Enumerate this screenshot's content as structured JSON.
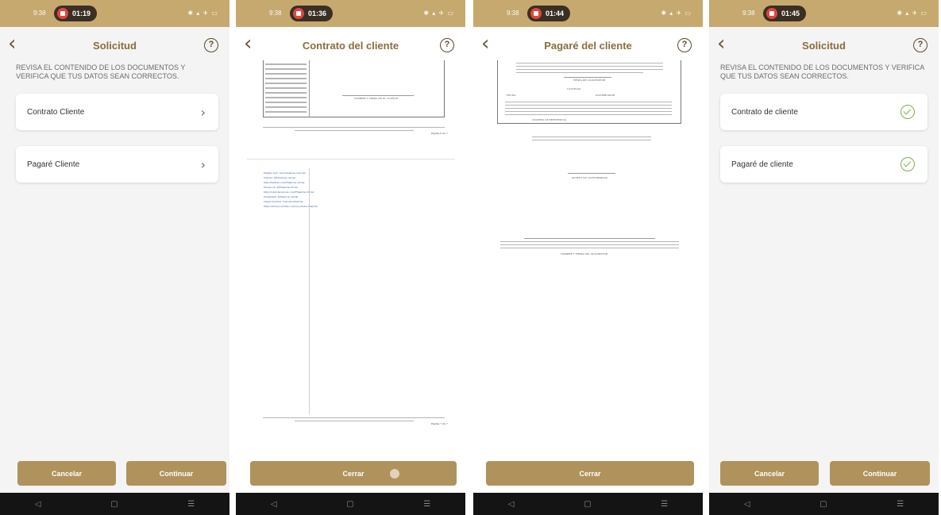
{
  "colors": {
    "brand": "#b0925c",
    "title": "#8a6d3b",
    "check": "#7cb342"
  },
  "screens": [
    {
      "status": {
        "time": "9:38",
        "recording": "01:19",
        "icons": "✱ ▴ ✈ ▭"
      },
      "header": {
        "title": "Solicitud"
      },
      "instructions": "REVISA EL CONTENIDO DE LOS DOCUMENTOS Y VERIFICA QUE TUS DATOS SEAN CORRECTOS.",
      "items": [
        {
          "label": "Contrato Cliente",
          "icon": "chevron-right-icon"
        },
        {
          "label": "Pagaré Cliente",
          "icon": "chevron-right-icon"
        }
      ],
      "buttons": {
        "cancel": "Cancelar",
        "continue": "Continuar"
      }
    },
    {
      "status": {
        "time": "9:38",
        "recording": "01:36",
        "icons": "✱ ▴ ✈ ▭"
      },
      "header": {
        "title": "Contrato del cliente"
      },
      "doc": {
        "signature_label": "NOMBRE Y FIRMA DE EL CLIENTE",
        "page_label_1": "Página 6 de 7",
        "page_label_2": "Página 7 de 7",
        "links": [
          "Página web: www.financia.com.mx",
          "Twitter: @Financia_oficial",
          "http://twitter.com/Financia_oficial",
          "Facebook: @Financia.oficial",
          "http://www.facebook.com/Financia.oficial",
          "Instagram: @financia_oficial",
          "Canal Youtube: Youtube.financia",
          "https://www.youtube.com/c/youtube.financia"
        ]
      },
      "buttons": {
        "close": "Cerrar"
      }
    },
    {
      "status": {
        "time": "9:38",
        "recording": "01:44",
        "icons": "✱ ▴ ✈ ▭"
      },
      "header": {
        "title": "Pagaré del cliente"
      },
      "doc": {
        "firm_label": "FIRMA DEL SUSCRIPTOR",
        "fecha_label": "FECHA",
        "cantidad_label": "CANTIDAD",
        "dist_label": "DISTRIBUIDOR",
        "ref_label": "NÚMERO DE REFERENCIA",
        "acepto_label": "ACEPTO DE CONFORMIDAD",
        "nombre_label": "NOMBRE Y FIRMA DEL SUSCRIPTOR"
      },
      "buttons": {
        "close": "Cerrar"
      }
    },
    {
      "status": {
        "time": "9:38",
        "recording": "01:45",
        "icons": "✱ ▴ ✈ ▭"
      },
      "header": {
        "title": "Solicitud"
      },
      "instructions": "REVISA EL CONTENIDO DE LOS DOCUMENTOS Y VERIFICA QUE TUS DATOS SEAN CORRECTOS.",
      "items": [
        {
          "label": "Contrato de cliente",
          "icon": "check-circle-icon"
        },
        {
          "label": "Pagaré de cliente",
          "icon": "check-circle-icon"
        }
      ],
      "buttons": {
        "cancel": "Cancelar",
        "continue": "Continuar"
      }
    }
  ],
  "navbar": {
    "back": "◁",
    "home": "▢",
    "menu": "☰"
  }
}
